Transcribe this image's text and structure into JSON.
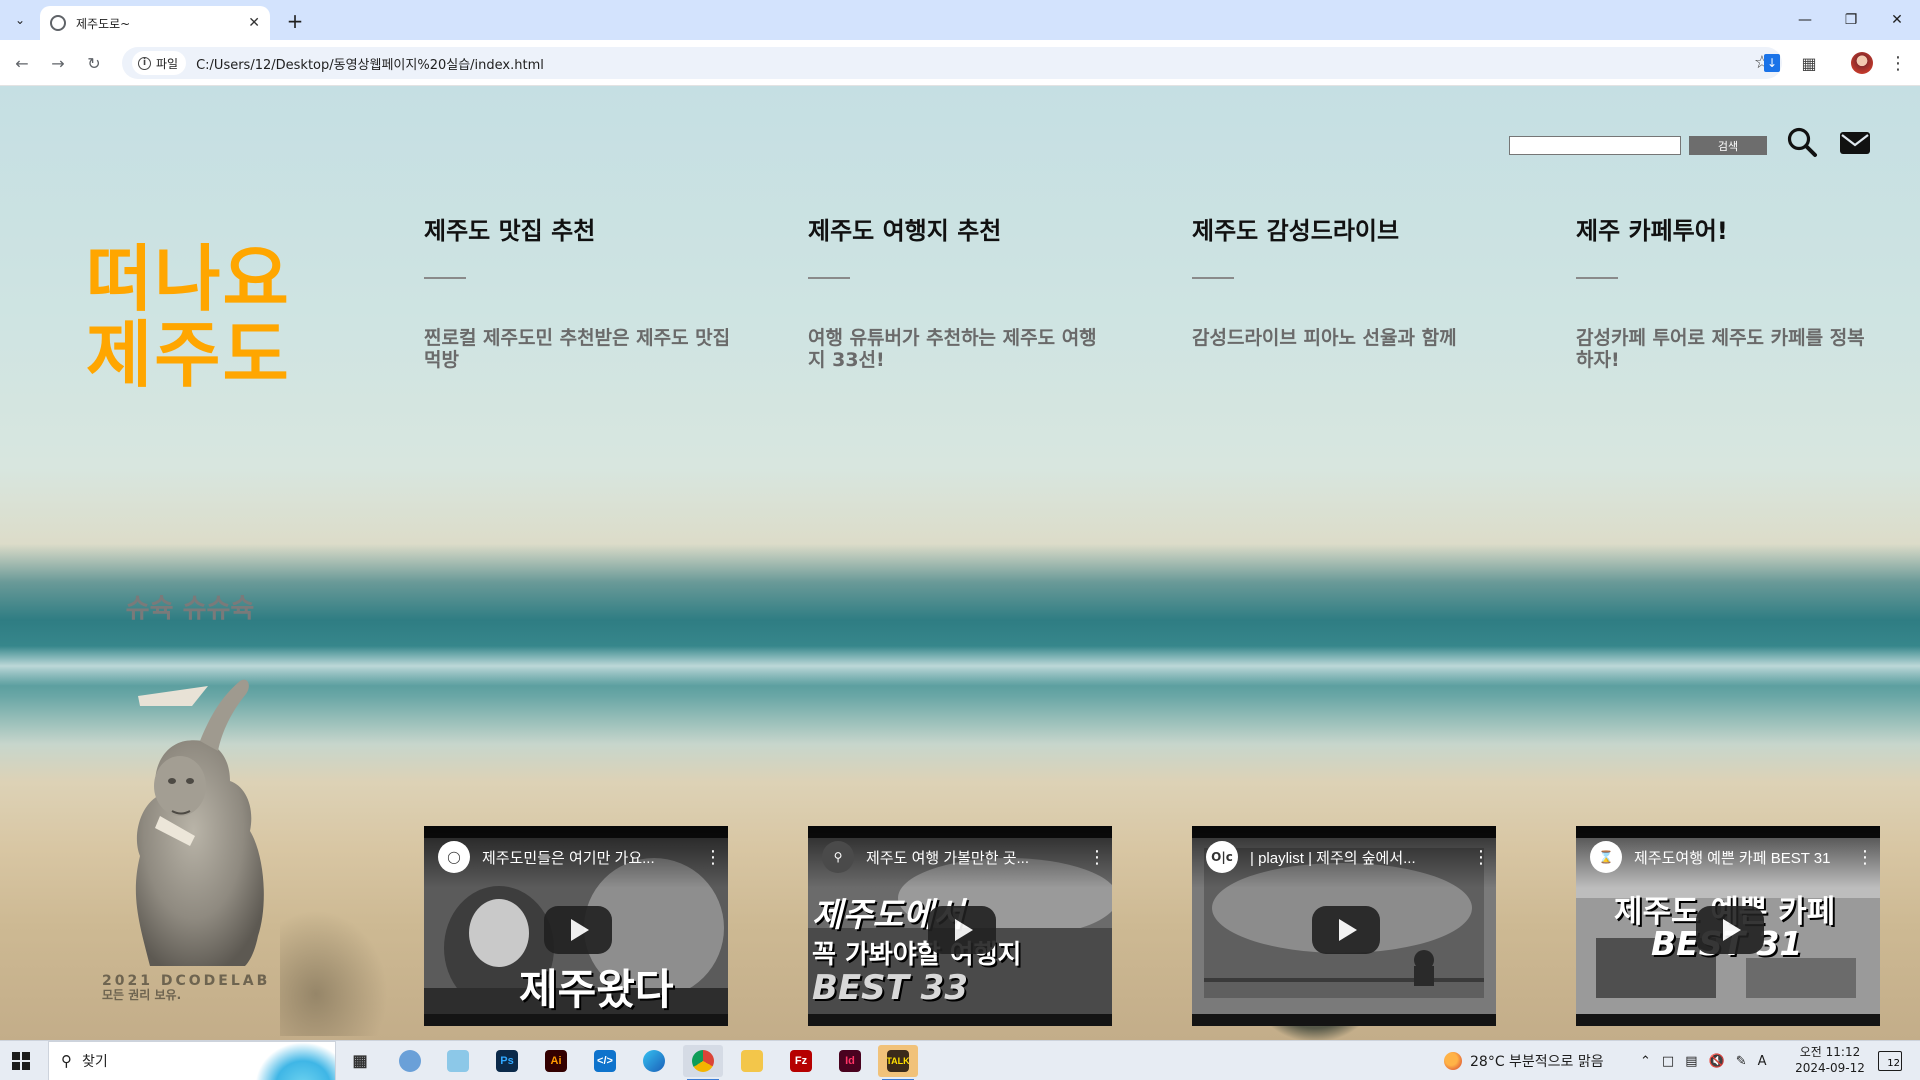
{
  "browser": {
    "tab_title": "제주도로~",
    "site_info_label": "파일",
    "url": "C:/Users/12/Desktop/동영상웹페이지%20실습/index.html"
  },
  "page": {
    "search": {
      "placeholder": "",
      "button_label": "검색"
    },
    "logo_line1": "떠나요",
    "logo_line2": "제주도",
    "columns": [
      {
        "title": "제주도 맛집 추천",
        "desc": "찐로컬 제주도민 추천받은 제주도 맛집 먹방"
      },
      {
        "title": "제주도 여행지 추천",
        "desc": "여행 유튜버가 추천하는 제주도 여행지 33선!"
      },
      {
        "title": "제주도 감성드라이브",
        "desc": "감성드라이브 피아노 선율과 함께"
      },
      {
        "title": "제주 카페투어!",
        "desc": "감성카페 투어로 제주도 카페를 정복하자!"
      }
    ],
    "sidebar": {
      "title": "슈슉 슈슈슉",
      "copyright_line1": "2021 DCODELAB",
      "copyright_line2": "모든 권리 보유."
    },
    "videos": [
      {
        "title": "제주도민들은 여기만 가요...",
        "thumb_text": "제주왔다",
        "channel_icon_text": ""
      },
      {
        "title": "제주도 여행 가볼만한 곳...",
        "thumb_text_line1": "제주도에서",
        "thumb_text_line2": "꼭 가봐야할 여행지",
        "thumb_text_line3": "BEST 33",
        "channel_icon_text": ""
      },
      {
        "title": "| playlist | 제주의 숲에서...",
        "channel_icon_text": "O|c"
      },
      {
        "title": "제주도여행 예쁜 카페 BEST 31",
        "thumb_text_line1": "제주도 예쁜 카페",
        "thumb_text_line2": "BEST 31",
        "channel_icon_text": ""
      }
    ]
  },
  "taskbar": {
    "search_text": "찾기",
    "weather": "28°C  부분적으로 맑음",
    "time": "오전 11:12",
    "date": "2024-09-12",
    "notification_count": "12",
    "ime_label": "A"
  }
}
